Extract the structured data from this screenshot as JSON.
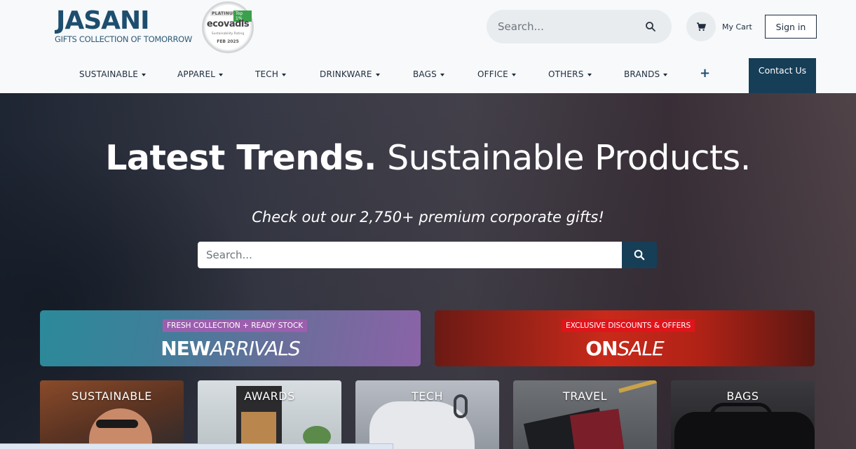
{
  "brand": {
    "name": "JASANI",
    "tagline": "GIFTS COLLECTION OF TOMORROW"
  },
  "badge": {
    "tier": "PLATINUM",
    "top": "Top 1%",
    "name": "ecovadis",
    "rating": "Sustainability Rating",
    "date": "FEB 2025"
  },
  "header": {
    "search_placeholder": "Search...",
    "cart_label": "My Cart",
    "signin_label": "Sign in",
    "contact_label": "Contact Us"
  },
  "nav": {
    "items": [
      {
        "label": "SUSTAINABLE"
      },
      {
        "label": "APPAREL"
      },
      {
        "label": "TECH"
      },
      {
        "label": "DRINKWARE"
      },
      {
        "label": "BAGS"
      },
      {
        "label": "OFFICE"
      },
      {
        "label": "OTHERS"
      },
      {
        "label": "BRANDS"
      }
    ],
    "plus": "+"
  },
  "hero": {
    "title_strong": "Latest Trends.",
    "title_light": "Sustainable Products.",
    "subtitle": "Check out our 2,750+ premium corporate gifts!",
    "search_placeholder": "Search..."
  },
  "promos": [
    {
      "tag": "FRESH COLLECTION + READY STOCK",
      "bold": "NEW",
      "italic": "ARRIVALS"
    },
    {
      "tag": "EXCLUSIVE DISCOUNTS & OFFERS",
      "bold": "ON",
      "italic": "SALE"
    }
  ],
  "categories": [
    {
      "label": "SUSTAINABLE"
    },
    {
      "label": "AWARDS"
    },
    {
      "label": "TECH"
    },
    {
      "label": "TRAVEL"
    },
    {
      "label": "BAGS"
    }
  ],
  "colors": {
    "primary": "#173e57",
    "brand": "#1d4e6e",
    "sale_red": "#e0141a",
    "new_purple": "#9b5fae"
  }
}
